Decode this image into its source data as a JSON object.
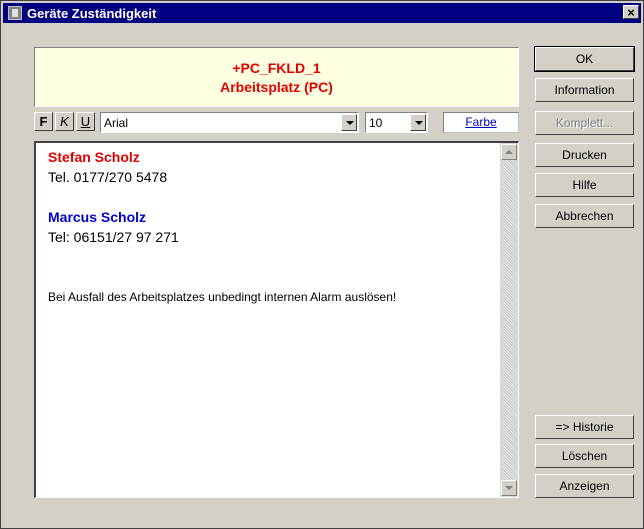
{
  "window": {
    "title": "Geräte Zuständigkeit",
    "close_label": "×"
  },
  "header": {
    "line1": "+PC_FKLD_1",
    "line2": "Arbeitsplatz (PC)"
  },
  "toolbar": {
    "bold_label": "F",
    "italic_label": "K",
    "underline_label": "U",
    "font_value": "Arial",
    "size_value": "10",
    "color_label": "Farbe"
  },
  "editor": {
    "contact1_name": "Stefan Scholz",
    "contact1_phone": "Tel. 0177/270 5478",
    "contact2_name": "Marcus Scholz",
    "contact2_phone": "Tel: 06151/27 97 271",
    "note": "Bei Ausfall des Arbeitsplatzes unbedingt internen Alarm auslösen!"
  },
  "buttons": {
    "ok": "OK",
    "information": "Information",
    "komplett": "Komplett...",
    "drucken": "Drucken",
    "hilfe": "Hilfe",
    "abbrechen": "Abbrechen",
    "historie": "=> Historie",
    "loeschen": "Löschen",
    "anzeigen": "Anzeigen"
  }
}
